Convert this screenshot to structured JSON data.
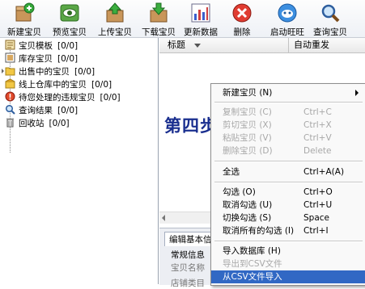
{
  "toolbar": {
    "buttons": [
      {
        "label": "新建宝贝",
        "icon": "add-box-icon"
      },
      {
        "label": "预览宝贝",
        "icon": "eye-icon"
      },
      {
        "label": "上传宝贝",
        "icon": "upload-box-icon"
      },
      {
        "label": "下载宝贝",
        "icon": "download-box-icon"
      },
      {
        "label": "更新数据",
        "icon": "chart-icon"
      },
      {
        "label": "删除",
        "icon": "delete-icon"
      },
      {
        "label": "启动旺旺",
        "icon": "wangwang-icon"
      },
      {
        "label": "查询宝贝",
        "icon": "search-icon"
      }
    ]
  },
  "tree": {
    "items": [
      {
        "label": "宝贝模板",
        "count": "[0/0]",
        "icon": "template-icon"
      },
      {
        "label": "库存宝贝",
        "count": "[0/0]",
        "icon": "stock-icon"
      },
      {
        "label": "出售中的宝贝",
        "count": "[0/0]",
        "icon": "folder-icon"
      },
      {
        "label": "线上仓库中的宝贝",
        "count": "[0/0]",
        "icon": "warehouse-icon"
      },
      {
        "label": "待您处理的违规宝贝",
        "count": "[0/0]",
        "icon": "warning-icon"
      },
      {
        "label": "查询结果",
        "count": "[0/0]",
        "icon": "search-result-icon"
      },
      {
        "label": "回收站",
        "count": "[0/0]",
        "icon": "recycle-bin-icon"
      }
    ]
  },
  "list": {
    "columns": [
      "标题",
      "自动重发"
    ]
  },
  "edit": {
    "tab_label": "编辑基本信",
    "group_label": "常规信息",
    "field1_label": "宝贝名称",
    "field2_label": "店铺类目"
  },
  "context_menu": {
    "items": [
      {
        "label": "新建宝贝 (N)",
        "shortcut": "",
        "disabled": false,
        "submenu": true
      },
      {
        "label": "复制宝贝 (C)",
        "shortcut": "Ctrl+C",
        "disabled": true
      },
      {
        "label": "剪切宝贝 (X)",
        "shortcut": "Ctrl+X",
        "disabled": true
      },
      {
        "label": "粘贴宝贝 (V)",
        "shortcut": "Ctrl+V",
        "disabled": true
      },
      {
        "label": "删除宝贝 (D)",
        "shortcut": "Delete",
        "disabled": true
      },
      {
        "label": "全选",
        "shortcut": "Ctrl+A(A)",
        "disabled": false
      },
      {
        "label": "勾选 (O)",
        "shortcut": "Ctrl+O",
        "disabled": false
      },
      {
        "label": "取消勾选 (U)",
        "shortcut": "Ctrl+U",
        "disabled": false
      },
      {
        "label": "切换勾选 (S)",
        "shortcut": "Space",
        "disabled": false
      },
      {
        "label": "取消所有的勾选 (I)",
        "shortcut": "Ctrl+I",
        "disabled": false
      },
      {
        "label": "导入数据库 (H)",
        "shortcut": "",
        "disabled": false
      },
      {
        "label": "导出到CSV文件",
        "shortcut": "",
        "disabled": true
      },
      {
        "label": "从CSV文件导入",
        "shortcut": "",
        "disabled": false,
        "selected": true
      }
    ]
  },
  "overlay": {
    "caption": "第四步：空白处右键"
  },
  "colors": {
    "menu_highlight": "#3168c4",
    "overlay_text": "#1a2f8f",
    "disabled_text": "#a8a8a8"
  }
}
